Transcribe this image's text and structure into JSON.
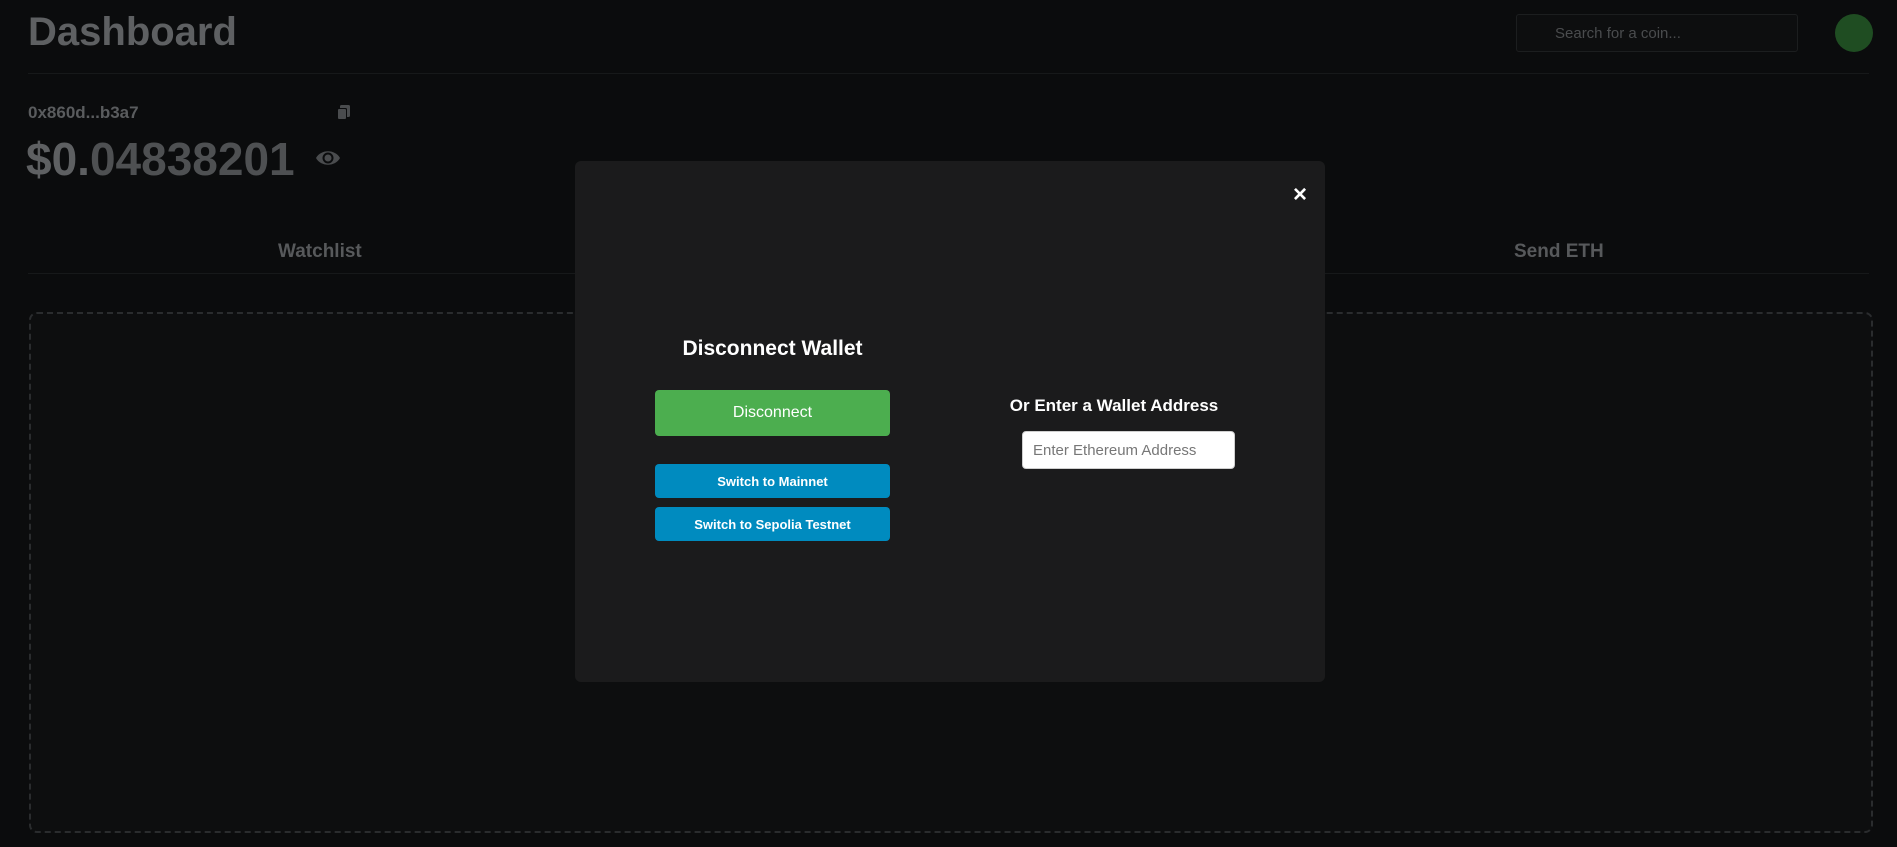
{
  "header": {
    "title": "Dashboard",
    "search_placeholder": "Search for a coin..."
  },
  "wallet": {
    "address": "0x860d...b3a7",
    "balance_dollars": "$0.",
    "balance_cents": "04838201"
  },
  "tabs": [
    {
      "label": "Watchlist"
    },
    {
      "label": "Send ETH"
    }
  ],
  "modal": {
    "close_label": "×",
    "title": "Disconnect Wallet",
    "disconnect_label": "Disconnect",
    "mainnet_label": "Switch to Mainnet",
    "sepolia_label": "Switch to Sepolia Testnet",
    "address_heading": "Or Enter a Wallet Address",
    "address_placeholder": "Enter Ethereum Address"
  },
  "colors": {
    "primary_green": "#4cae4f",
    "network_blue": "#008bbf",
    "modal_bg": "#1b1b1c",
    "page_bg": "#0b0c0d"
  },
  "icons": [
    "copy-icon",
    "eye-icon",
    "close-icon"
  ]
}
